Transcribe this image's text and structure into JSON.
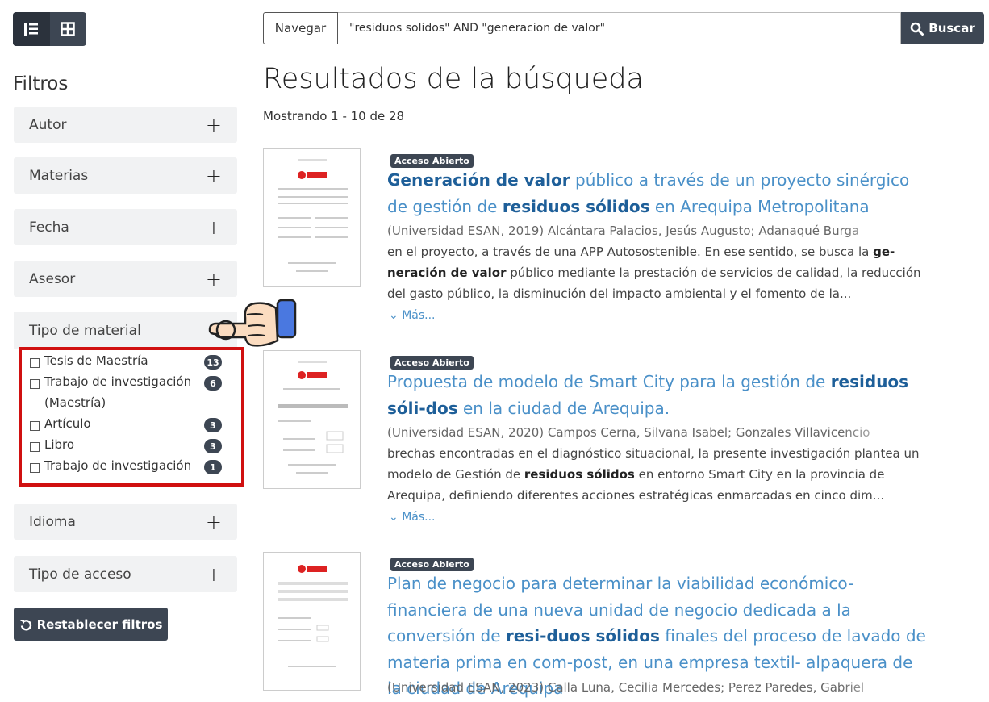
{
  "search": {
    "scope_label": "Navegar",
    "query": "\"residuos solidos\" AND \"generacion de valor\"",
    "button_label": "Buscar"
  },
  "filters": {
    "title": "Filtros",
    "facets": [
      {
        "label": "Autor"
      },
      {
        "label": "Materias"
      },
      {
        "label": "Fecha"
      },
      {
        "label": "Asesor"
      },
      {
        "label": "Tipo de material"
      },
      {
        "label": "Idioma"
      },
      {
        "label": "Tipo de acceso"
      }
    ],
    "material_types": [
      {
        "label": "Tesis de Maestría",
        "count": "13"
      },
      {
        "label": "Trabajo de investigación (Maestría)",
        "count": "6"
      },
      {
        "label": "Artículo",
        "count": "3"
      },
      {
        "label": "Libro",
        "count": "3"
      },
      {
        "label": "Trabajo de investigación",
        "count": "1"
      }
    ],
    "reset_label": "Restablecer filtros"
  },
  "results": {
    "title": "Resultados de la búsqueda",
    "showing": "Mostrando 1 - 10 de 28",
    "badge": "Acceso Abierto",
    "more_label": "Más...",
    "items": [
      {
        "title_parts": [
          "Generación de valor",
          " público a través de un proyecto sinérgico de gestión de ",
          "residuos sólidos",
          " en Arequipa Metropolitana"
        ],
        "meta": "(Universidad ESAN, 2019) Alcántara Palacios, Jesús Augusto; Adanaqué Burga",
        "snippet_parts": [
          "en el proyecto, a través de una APP Autosostenible. En ese sentido, se busca la ",
          "ge-neración de valor",
          " público mediante la prestación de servicios de calidad, la reducción del gasto público, la disminución del impacto ambiental y el fomento de la..."
        ]
      },
      {
        "title_parts": [
          "Propuesta de modelo de Smart City para la gestión de ",
          "residuos sóli-dos",
          " en la ciudad de Arequipa."
        ],
        "meta": "(Universidad ESAN, 2020) Campos Cerna, Silvana Isabel; Gonzales Villavicencio",
        "snippet_parts": [
          "brechas encontradas en el diagnóstico situacional, la presente investigación plantea un modelo de Gestión de ",
          "residuos sólidos",
          " en entorno Smart City en la provincia de Arequipa, definiendo diferentes acciones estratégicas enmarcadas en cinco dim..."
        ]
      },
      {
        "title_parts": [
          "Plan de negocio para determinar la viabilidad económico-financiera de una nueva unidad de negocio dedicada a la conversión de ",
          "resi-duos sólidos",
          " finales del proceso de lavado de materia prima en com-post, en una empresa textil- alpaquera de la ciudad de Arequipa"
        ],
        "meta": "(Universidad ESAN, 2023) Calla Luna, Cecilia Mercedes; Perez Paredes, Gabriel"
      }
    ]
  }
}
